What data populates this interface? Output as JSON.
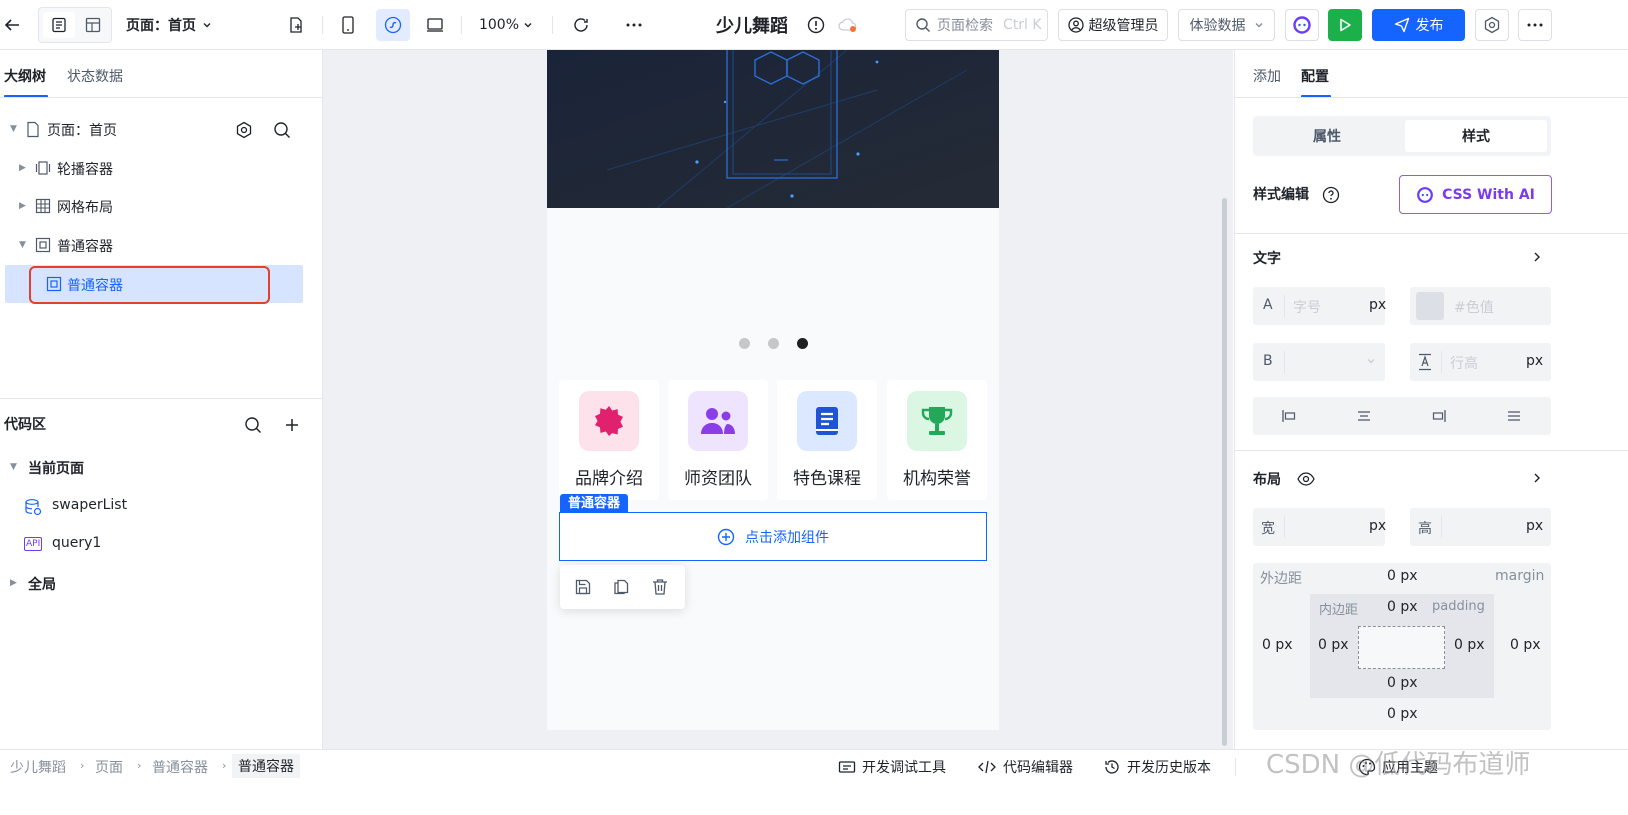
{
  "topbar": {
    "page_label": "页面：首页",
    "zoom": "100%",
    "app_title": "少儿舞蹈",
    "search_placeholder": "页面检索",
    "search_shortcut": "Ctrl K",
    "admin_label": "超级管理员",
    "data_label": "体验数据",
    "publish_label": "发布"
  },
  "left": {
    "tabs": [
      "大纲树",
      "状态数据"
    ],
    "tree": {
      "page_node": "页面：首页",
      "items": [
        "轮播容器",
        "网格布局",
        "普通容器",
        "普通容器"
      ]
    },
    "code_area": {
      "title": "代码区",
      "current_page": "当前页面",
      "items": [
        "swaperList",
        "query1"
      ],
      "global": "全局"
    }
  },
  "canvas": {
    "nav_items": [
      "品牌介绍",
      "师资团队",
      "特色课程",
      "机构荣誉"
    ],
    "container_tag": "普通容器",
    "add_component": "点击添加组件"
  },
  "right": {
    "tabs": [
      "添加",
      "配置"
    ],
    "segment": [
      "属性",
      "样式"
    ],
    "style_edit": "样式编辑",
    "css_ai": "CSS With AI",
    "text_section": "文字",
    "font_size_placeholder": "字号",
    "unit_px": "px",
    "color_placeholder": "#色值",
    "line_height_placeholder": "行高",
    "letter_a": "A",
    "letter_b": "B",
    "layout_section": "布局",
    "width_label": "宽",
    "height_label": "高",
    "margin_label": "外边距",
    "margin_en": "margin",
    "padding_label": "内边距",
    "padding_en": "padding",
    "zero_px": "0 px"
  },
  "bottom": {
    "breadcrumbs": [
      "少儿舞蹈",
      "页面",
      "普通容器",
      "普通容器"
    ],
    "tools": [
      "开发调试工具",
      "代码编辑器",
      "开发历史版本",
      "应用主题"
    ],
    "watermark": "CSDN @低代码布道师"
  },
  "colors": {
    "primary": "#1664ff",
    "green": "#1cb04b",
    "selected_bg": "#d6e4ff",
    "highlight_border": "#e0412d"
  }
}
